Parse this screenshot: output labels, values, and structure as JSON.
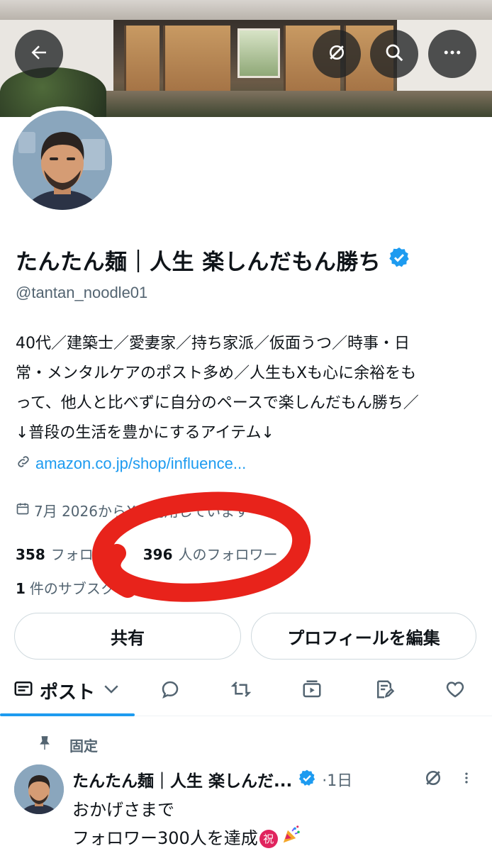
{
  "header": {
    "back_icon": "arrow-left-icon",
    "grok_icon": "grok-slash-icon",
    "search_icon": "search-icon",
    "more_icon": "more-horizontal-icon"
  },
  "profile": {
    "display_name": "たんたん麺｜人生 楽しんだもん勝ち",
    "handle": "@tantan_noodle01",
    "bio_lines": [
      "40代／建築士／愛妻家／持ち家派／仮面うつ／時事・日",
      "常・メンタルケアのポスト多め／人生もXも心に余裕をも",
      "って、他人と比べずに自分のペースで楽しんだもん勝ち／",
      "↓普段の生活を豊かにするアイテム↓"
    ],
    "link": "amazon.co.jp/shop/influence...",
    "joined": "7月 2026からXを利用しています",
    "following_count": "358",
    "following_label": "フォロー中",
    "followers_count": "396",
    "followers_label": "人のフォロワー",
    "subscriptions_count": "1",
    "subscriptions_label": "件のサブスクリプション",
    "verified_color": "#1d9bf0"
  },
  "actions": {
    "share_label": "共有",
    "edit_label": "プロフィールを編集"
  },
  "tabs": {
    "posts_label": "ポスト",
    "icons": [
      "posts-icon",
      "reply-icon",
      "repost-icon",
      "media-icon",
      "article-icon",
      "like-icon"
    ]
  },
  "pinned_post": {
    "pinned_label": "固定",
    "author": "たんたん麺｜人生 楽しんだ...",
    "time": "·1日",
    "text_line1": "おかげさまで",
    "text_line2": "フォロワー300人を達成",
    "emoji_badge": "祝"
  },
  "colors": {
    "accent": "#1d9bf0",
    "annotation_red": "#e8231b",
    "text_primary": "#0f1419",
    "text_secondary": "#536471"
  }
}
